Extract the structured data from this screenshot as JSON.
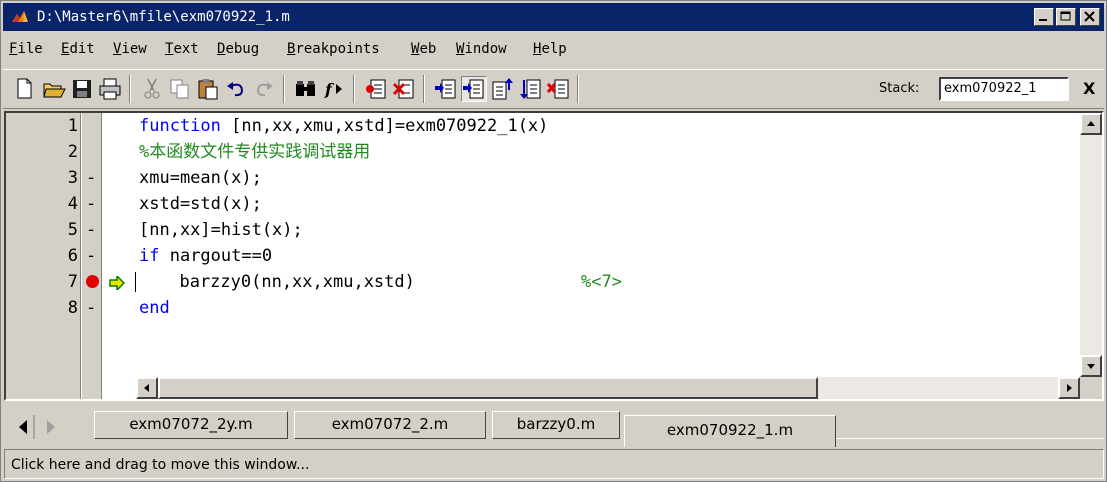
{
  "window": {
    "title": "D:\\Master6\\mfile\\exm070922_1.m",
    "icon": "matlab-logo-icon",
    "controls": [
      "minimize-icon",
      "maximize-icon",
      "close-icon"
    ]
  },
  "menu": [
    "File",
    "Edit",
    "View",
    "Text",
    "Debug",
    "Breakpoints",
    "Web",
    "Window",
    "Help"
  ],
  "toolbar": {
    "buttons": [
      "new-file-icon",
      "open-folder-icon",
      "save-disk-icon",
      "print-icon",
      "cut-icon",
      "copy-icon",
      "paste-icon",
      "undo-icon",
      "redo-icon",
      "find-binoculars-icon",
      "function-icon",
      "set-breakpoint-icon",
      "clear-breakpoint-icon",
      "step-icon",
      "step-in-icon",
      "step-out-icon",
      "continue-icon",
      "exit-debug-icon"
    ],
    "stack_label": "Stack:",
    "stack_value": "exm070922_1",
    "stack_close": "X"
  },
  "editor": {
    "lines": [
      {
        "num": "1",
        "mark": "",
        "code": "function [nn,xx,xmu,xstd]=exm070922_1(x)",
        "keyword": "function",
        "rest": " [nn,xx,xmu,xstd]=exm070922_1(x)"
      },
      {
        "num": "2",
        "mark": "",
        "code": "%本函数文件专供实践调试器用",
        "comment": true
      },
      {
        "num": "3",
        "mark": "-",
        "code": "xmu=mean(x);"
      },
      {
        "num": "4",
        "mark": "-",
        "code": "xstd=std(x);"
      },
      {
        "num": "5",
        "mark": "-",
        "code": "[nn,xx]=hist(x);"
      },
      {
        "num": "6",
        "mark": "-",
        "code": "if nargout==0",
        "keyword": "if",
        "rest": " nargout==0"
      },
      {
        "num": "7",
        "mark": "breakpoint",
        "code": "  barzzy0(nn,xx,xmu,xstd)",
        "trailing_comment": "%<7>",
        "current": true
      },
      {
        "num": "8",
        "mark": "-",
        "code": "end",
        "keyword": "end",
        "rest": ""
      }
    ]
  },
  "tabs": [
    {
      "label": "exm07072_2y.m",
      "active": false
    },
    {
      "label": "exm07072_2.m",
      "active": false
    },
    {
      "label": "barzzy0.m",
      "active": false
    },
    {
      "label": "exm070922_1.m",
      "active": true
    }
  ],
  "status": "Click here and drag to move this window...",
  "colors": {
    "titlebar": "#0a246a",
    "keyword": "#0000ff",
    "comment": "#228b22",
    "breakpoint": "#e00000",
    "current_line_arrow": "#00a000"
  }
}
